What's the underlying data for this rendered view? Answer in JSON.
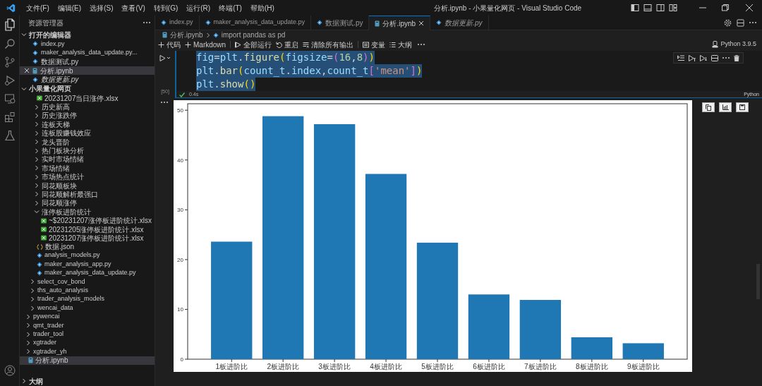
{
  "window": {
    "title": "分析.ipynb - 小果量化网页 - Visual Studio Code"
  },
  "menu": [
    "文件(F)",
    "编辑(E)",
    "选择(S)",
    "查看(V)",
    "转到(G)",
    "运行(R)",
    "终端(T)",
    "帮助(H)"
  ],
  "sidebar": {
    "title": "资源管理器",
    "open_editors": {
      "title": "打开的编辑器",
      "expanded": true,
      "items": [
        {
          "label": "index.py",
          "kind": "py",
          "selected": false,
          "preview": false
        },
        {
          "label": "maker_analysis_data_update.py...",
          "kind": "py",
          "selected": false,
          "preview": false
        },
        {
          "label": "数据测试.py",
          "kind": "py",
          "selected": false,
          "preview": false
        },
        {
          "label": "分析.ipynb",
          "kind": "ipynb",
          "selected": true,
          "preview": false
        },
        {
          "label": "数据更新.py",
          "kind": "py",
          "selected": false,
          "preview": true
        }
      ]
    },
    "workspace": {
      "title": "小果量化网页",
      "expanded": true,
      "items": [
        {
          "children": [
            {
              "children": [
                {
                  "label": "20231207当日涨停.xlsx",
                  "kind": "xlsx"
                },
                {
                  "label": "历史新高",
                  "kind": "folder",
                  "expanded": false
                },
                {
                  "label": "历史涨跌停",
                  "kind": "folder",
                  "expanded": false
                },
                {
                  "label": "连板天梯",
                  "kind": "folder",
                  "expanded": false
                },
                {
                  "label": "连板股赚钱效应",
                  "kind": "folder",
                  "expanded": false
                },
                {
                  "label": "龙头晋阶",
                  "kind": "folder",
                  "expanded": false
                },
                {
                  "label": "热门板块分析",
                  "kind": "folder",
                  "expanded": false
                },
                {
                  "label": "实时市场情绪",
                  "kind": "folder",
                  "expanded": false
                },
                {
                  "label": "市场情绪",
                  "kind": "folder",
                  "expanded": false
                },
                {
                  "label": "市场热点统计",
                  "kind": "folder",
                  "expanded": false
                },
                {
                  "label": "同花顺板块",
                  "kind": "folder",
                  "expanded": false
                },
                {
                  "label": "同花顺解析最强口",
                  "kind": "folder",
                  "expanded": false
                },
                {
                  "label": "同花顺涨停",
                  "kind": "folder",
                  "expanded": false
                },
                {
                  "label": "涨停板进阶统计",
                  "kind": "folder",
                  "expanded": true,
                  "children": [
                    {
                      "label": "~$20231207涨停板进阶统计.xlsx",
                      "kind": "xlsx"
                    },
                    {
                      "label": "20231205涨停板进阶统计.xlsx",
                      "kind": "xlsx"
                    },
                    {
                      "label": "20231207涨停板进阶统计.xlsx",
                      "kind": "xlsx"
                    }
                  ]
                },
                {
                  "label": "数据.json",
                  "kind": "json"
                },
                {
                  "label": "analysis_models.py",
                  "kind": "py"
                },
                {
                  "label": "maker_analysis_app.py",
                  "kind": "py"
                },
                {
                  "label": "maker_analysis_data_update.py",
                  "kind": "py"
                }
              ]
            },
            {
              "label": "select_cov_bond",
              "kind": "folder",
              "expanded": false
            },
            {
              "label": "ths_auto_analysis",
              "kind": "folder",
              "expanded": false
            },
            {
              "label": "trader_analysis_models",
              "kind": "folder",
              "expanded": false
            },
            {
              "label": "wencai_data",
              "kind": "folder",
              "expanded": false
            }
          ]
        },
        {
          "label": "pywencai",
          "kind": "folder",
          "expanded": false
        },
        {
          "label": "qmt_trader",
          "kind": "folder",
          "expanded": false
        },
        {
          "label": "trader_tool",
          "kind": "folder",
          "expanded": false
        },
        {
          "label": "xgtrader",
          "kind": "folder",
          "expanded": false
        },
        {
          "label": "xgtrader_yh",
          "kind": "folder",
          "expanded": false
        },
        {
          "label": "分析.ipynb",
          "kind": "ipynb",
          "selected": true
        }
      ]
    },
    "outline": {
      "title": "大纲",
      "expanded": false
    }
  },
  "tabs": [
    {
      "label": "index.py",
      "kind": "py",
      "selected": false,
      "preview": false
    },
    {
      "label": "maker_analysis_data_update.py",
      "kind": "py",
      "selected": false,
      "preview": false
    },
    {
      "label": "数据测试.py",
      "kind": "py",
      "selected": false,
      "preview": false
    },
    {
      "label": "分析.ipynb",
      "kind": "ipynb",
      "selected": true,
      "preview": false
    },
    {
      "label": "数据更新.py",
      "kind": "py",
      "selected": false,
      "preview": true
    }
  ],
  "breadcrumb": [
    "分析.ipynb",
    "import pandas as pd"
  ],
  "toolbar": [
    {
      "label": "代码",
      "kind": "add"
    },
    {
      "label": "Markdown",
      "kind": "add"
    },
    {
      "label": "全部运行",
      "kind": "run"
    },
    {
      "label": "重启",
      "kind": "restart"
    },
    {
      "label": "清除所有输出",
      "kind": "clear"
    },
    {
      "label": "变量",
      "kind": "variables"
    },
    {
      "label": "大纲",
      "kind": "outline"
    }
  ],
  "kernel": "Python 3.9.5",
  "cell": {
    "execution_count": "[50]",
    "duration": "0.4s",
    "language": "Python",
    "lines": [
      "fig=plt.figure(figsize=(16,8))",
      "plt.bar(count_t.index,count_t['mean'])",
      "plt.show()"
    ]
  },
  "output": {
    "chart_data": {
      "type": "bar",
      "categories": [
        "1板进阶比",
        "2板进阶比",
        "3板进阶比",
        "4板进阶比",
        "5板进阶比",
        "6板进阶比",
        "7板进阶比",
        "8板进阶比",
        "9板进阶比"
      ],
      "series": [
        {
          "color": "#1f77b4",
          "values": [
            23.6,
            48.8,
            47.2,
            37.2,
            23.4,
            13.0,
            11.9,
            4.4,
            3.2
          ]
        }
      ],
      "ylim": [
        0,
        51.3
      ],
      "yticks": [
        0,
        10,
        20,
        30,
        40,
        50
      ]
    }
  }
}
